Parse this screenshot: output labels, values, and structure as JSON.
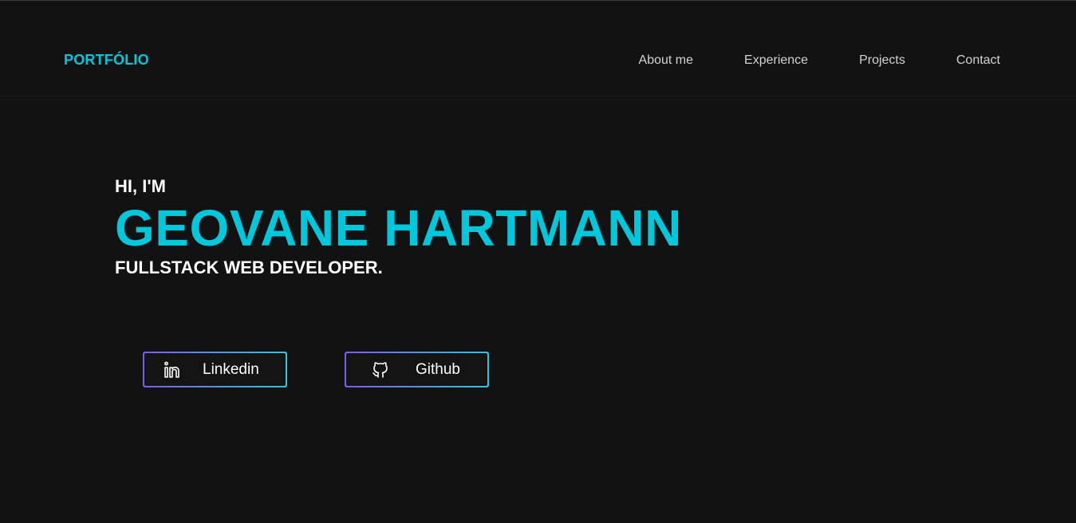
{
  "header": {
    "logo": "PORTFÓLIO",
    "nav": [
      "About me",
      "Experience",
      "Projects",
      "Contact"
    ]
  },
  "hero": {
    "greeting": "HI, I'M",
    "name": "GEOVANE HARTMANN",
    "role": "FULLSTACK WEB DEVELOPER."
  },
  "links": {
    "linkedin": {
      "label": "Linkedin",
      "icon": "linkedin-icon"
    },
    "github": {
      "label": "Github",
      "icon": "github-icon"
    }
  },
  "colors": {
    "background": "#121212",
    "accent": "#00c8dc",
    "gradient_start": "#7a5cf0",
    "gradient_end": "#2fc6de"
  }
}
